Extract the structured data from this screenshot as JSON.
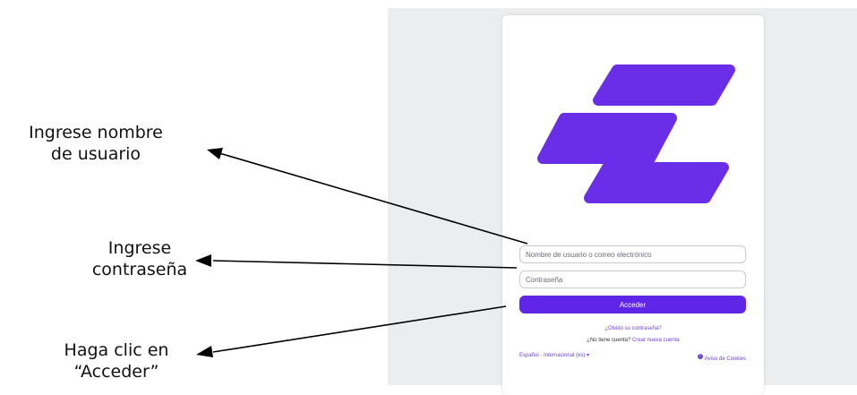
{
  "annotations": {
    "username": "Ingrese nombre\nde usuario",
    "password": "Ingrese\ncontraseña",
    "login": "Haga clic en\n“Acceder”"
  },
  "login_form": {
    "username_placeholder": "Nombre de usuario o correo electrónico",
    "password_placeholder": "Contraseña",
    "submit_label": "Acceder",
    "forgot_link": "¿Olvidó su contraseña?",
    "no_account_text": "¿No tiene cuenta?",
    "create_account_link": "Crear nueva cuenta",
    "language_selector": "Español - Internacional (es)",
    "cookies_link": "Aviso de Cookies"
  },
  "colors": {
    "brand": "#6125e8",
    "logo": "#6a2ee8",
    "link": "#6a42d8",
    "panel_bg": "#ecedef"
  },
  "icons": [
    "logo-icon",
    "arrow-icon",
    "chevron-down-icon",
    "info-icon"
  ]
}
